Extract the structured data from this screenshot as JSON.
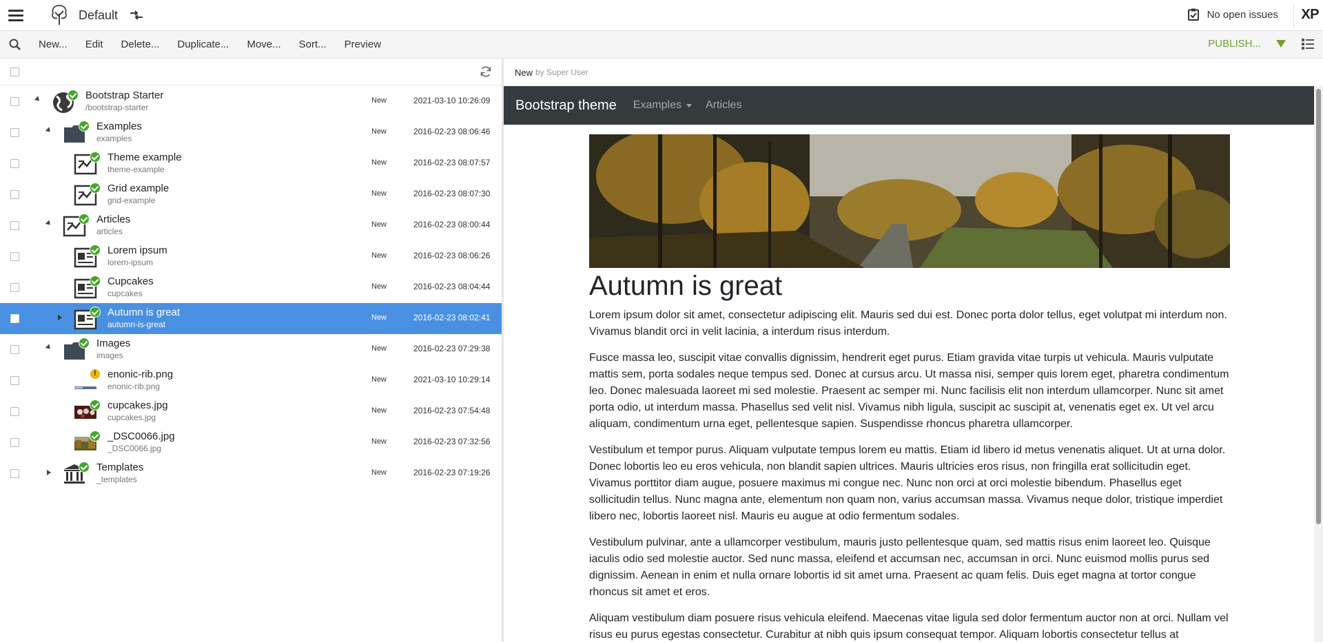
{
  "topbar": {
    "project": "Default",
    "issues_label": "No open issues",
    "logo_text": "XP"
  },
  "toolbar": {
    "new": "New...",
    "edit": "Edit",
    "delete": "Delete...",
    "duplicate": "Duplicate...",
    "move": "Move...",
    "sort": "Sort...",
    "preview": "Preview",
    "publish": "PUBLISH..."
  },
  "tree": {
    "rows": [
      {
        "name": "Bootstrap Starter",
        "path": "/bootstrap-starter",
        "status": "New",
        "date": "2021-03-10 10:26:09",
        "icon": "site-globe-icon"
      },
      {
        "name": "Examples",
        "path": "examples",
        "status": "New",
        "date": "2016-02-23 08:06:46",
        "icon": "folder-icon"
      },
      {
        "name": "Theme example",
        "path": "theme-example",
        "status": "New",
        "date": "2016-02-23 08:07:57",
        "icon": "page-template-icon"
      },
      {
        "name": "Grid example",
        "path": "grid-example",
        "status": "New",
        "date": "2016-02-23 08:07:30",
        "icon": "page-template-icon"
      },
      {
        "name": "Articles",
        "path": "articles",
        "status": "New",
        "date": "2016-02-23 08:00:44",
        "icon": "page-template-icon"
      },
      {
        "name": "Lorem ipsum",
        "path": "lorem-ipsum",
        "status": "New",
        "date": "2016-02-23 08:06:26",
        "icon": "article-icon"
      },
      {
        "name": "Cupcakes",
        "path": "cupcakes",
        "status": "New",
        "date": "2016-02-23 08:04:44",
        "icon": "article-icon"
      },
      {
        "name": "Autumn is great",
        "path": "autumn-is-great",
        "status": "New",
        "date": "2016-02-23 08:02:41",
        "icon": "article-icon"
      },
      {
        "name": "Images",
        "path": "images",
        "status": "New",
        "date": "2016-02-23 07:29:38",
        "icon": "folder-icon"
      },
      {
        "name": "enonic-rib.png",
        "path": "enonic-rib.png",
        "status": "New",
        "date": "2021-03-10 10:29:14",
        "icon": "image-thumbnail-icon"
      },
      {
        "name": "cupcakes.jpg",
        "path": "cupcakes.jpg",
        "status": "New",
        "date": "2016-02-23 07:54:48",
        "icon": "image-thumbnail-icon"
      },
      {
        "name": "_DSC0066.jpg",
        "path": "_DSC0066.jpg",
        "status": "New",
        "date": "2016-02-23 07:32:56",
        "icon": "image-thumbnail-icon"
      },
      {
        "name": "Templates",
        "path": "_templates",
        "status": "New",
        "date": "2016-02-23 07:19:26",
        "icon": "templates-icon"
      }
    ]
  },
  "preview": {
    "status": "New",
    "by": "by Super User",
    "brand": "Bootstrap theme",
    "nav_examples": "Examples",
    "nav_articles": "Articles",
    "title": "Autumn is great",
    "paragraphs": [
      "Lorem ipsum dolor sit amet, consectetur adipiscing elit. Mauris sed dui est. Donec porta dolor tellus, eget volutpat mi interdum non. Vivamus blandit orci in velit lacinia, a interdum risus interdum.",
      "Fusce massa leo, suscipit vitae convallis dignissim, hendrerit eget purus. Etiam gravida vitae turpis ut vehicula. Mauris vulputate mattis sem, porta sodales neque tempus sed. Donec at cursus arcu. Ut massa nisi, semper quis lorem eget, pharetra condimentum leo. Donec malesuada laoreet mi sed molestie. Praesent ac semper mi. Nunc facilisis elit non interdum ullamcorper. Nunc sit amet porta odio, ut interdum massa. Phasellus sed velit nisl. Vivamus nibh ligula, suscipit ac suscipit at, venenatis eget ex. Ut vel arcu aliquam, condimentum urna eget, pellentesque sapien. Suspendisse rhoncus pharetra ullamcorper.",
      "Vestibulum et tempor purus. Aliquam vulputate tempus lorem eu mattis. Etiam id libero id metus venenatis aliquet. Ut at urna dolor. Donec lobortis leo eu eros vehicula, non blandit sapien ultrices. Mauris ultricies eros risus, non fringilla erat sollicitudin eget. Vivamus porttitor diam augue, posuere maximus mi congue nec. Nunc non orci at orci molestie bibendum. Phasellus eget sollicitudin tellus. Nunc magna ante, elementum non quam non, varius accumsan massa. Vivamus neque dolor, tristique imperdiet libero nec, lobortis laoreet nisl. Mauris eu augue at odio fermentum sodales.",
      "Vestibulum pulvinar, ante a ullamcorper vestibulum, mauris justo pellentesque quam, sed mattis risus enim laoreet leo. Quisque iaculis odio sed molestie auctor. Sed nunc massa, eleifend et accumsan nec, accumsan in orci. Nunc euismod mollis purus sed dignissim. Aenean in enim et nulla ornare lobortis id sit amet urna. Praesent ac quam felis. Duis eget magna at tortor congue rhoncus sit amet et eros.",
      "Aliquam vestibulum diam posuere risus vehicula eleifend. Maecenas vitae ligula sed dolor fermentum auctor non at orci. Nullam vel risus eu purus egestas consectetur. Curabitur at nibh quis ipsum consequat tempor. Aliquam lobortis consectetur tellus at"
    ]
  },
  "colors": {
    "selected_row": "#4a90e2",
    "publish_green": "#6fa22c",
    "status_green": "#45a62b",
    "navbar_dark": "#343a40"
  }
}
